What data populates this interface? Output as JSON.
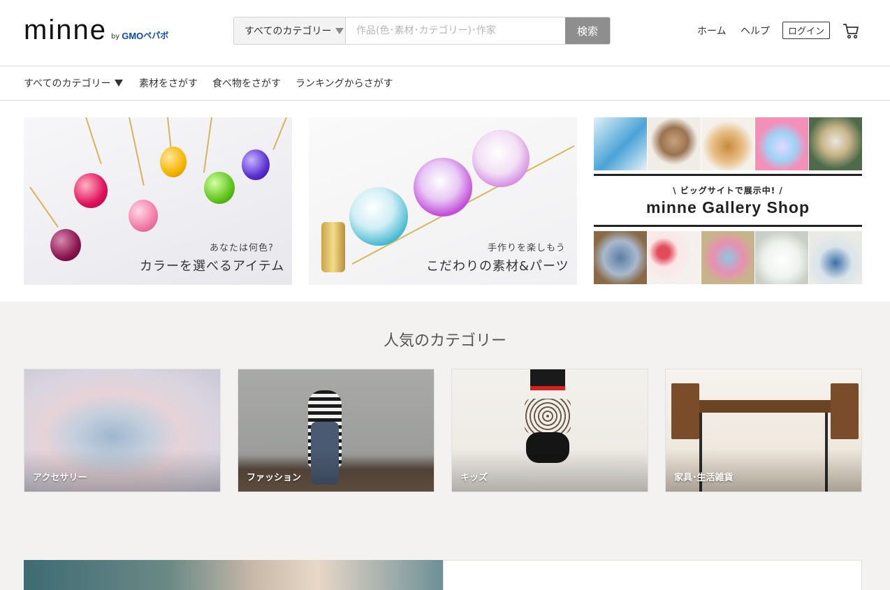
{
  "header": {
    "logo": {
      "word": "minne",
      "by": "by",
      "gmo": "GMO",
      "pepabo": "ペパボ"
    },
    "search": {
      "category": "すべてのカテゴリー",
      "placeholder": "作品(色･素材･カテゴリー)･作家",
      "button": "検索"
    },
    "nav": {
      "home": "ホーム",
      "help": "ヘルプ",
      "login": "ログイン"
    },
    "cart_icon": "cart-icon"
  },
  "category_nav": {
    "all": "すべてのカテゴリー",
    "items": [
      "素材をさがす",
      "食べ物をさがす",
      "ランキングからさがす"
    ]
  },
  "banners": [
    {
      "sub": "あなたは何色?",
      "main": "カラーを選べるアイテム"
    },
    {
      "sub": "手作りを楽しもう",
      "main": "こだわりの素材&パーツ"
    },
    {
      "sub": "\\ ビッグサイトで展示中! /",
      "main": "minne Gallery Shop"
    }
  ],
  "popular": {
    "title": "人気のカテゴリー",
    "cards": [
      "アクセサリー",
      "ファッション",
      "キッズ",
      "家具･生活雑貨"
    ]
  },
  "colors": {
    "search_button": "#8e8e8e",
    "section_bg": "#f3f2f0",
    "logo_blue": "#0a4aa8"
  }
}
